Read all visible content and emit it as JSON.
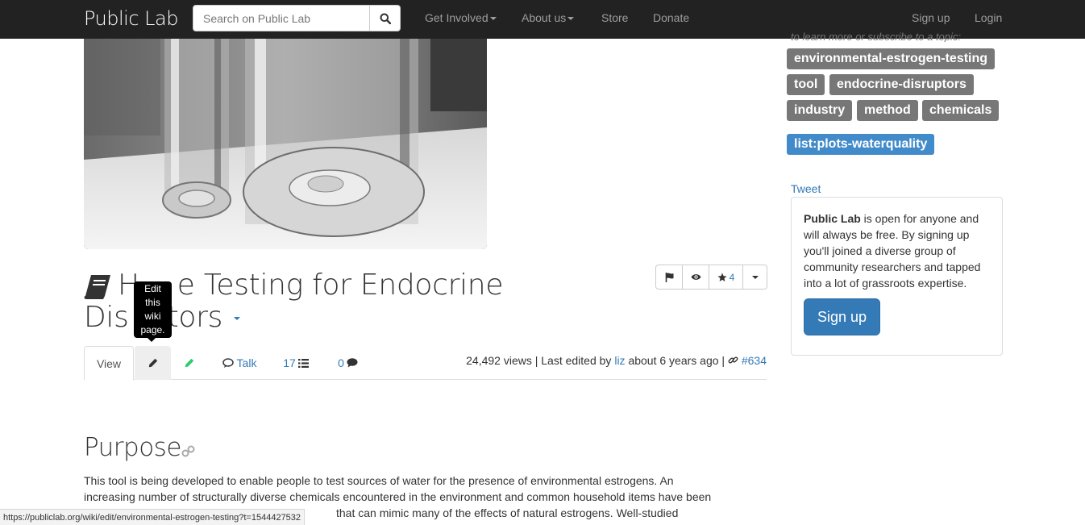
{
  "navbar": {
    "brand": "Public Lab",
    "search_placeholder": "Search on Public Lab",
    "items": [
      "Get Involved",
      "About us",
      "Store",
      "Donate"
    ],
    "signup": "Sign up",
    "login": "Login"
  },
  "page": {
    "title": "Home Testing for Endocrine Disruptors",
    "title_part1": "H",
    "title_part2": "e Testing for Endocrine",
    "title_part3": "Dis",
    "title_part4": "tors",
    "tooltip": "Edit this wiki page.",
    "tooltip_lines": [
      "Edit",
      "this",
      "wiki",
      "page."
    ],
    "like_count": "4",
    "tabs": {
      "view": "View",
      "talk": "Talk",
      "revisions": "17",
      "comments": "0"
    },
    "meta": {
      "views": "24,492 views | Last edited by",
      "author": "liz",
      "time": "about 6 years ago |",
      "node": "#634"
    }
  },
  "content": {
    "heading": "Purpose",
    "paragraph_line1": "This tool is being developed to enable people to test sources of water for the presence of environmental estrogens. An",
    "paragraph_line2": "increasing number of structurally diverse chemicals encountered in the environment and common household items have been",
    "paragraph_line3": "that can mimic many of the effects of natural estrogens. Well-studied"
  },
  "statusbar": {
    "url": "https://publiclab.org/wiki/edit/environmental-estrogen-testing?t=1544427532"
  },
  "sidebar": {
    "cut_text": "to learn more or subscribe to a topic:",
    "tags": [
      "environmental-estrogen-testing",
      "tool",
      "endocrine-disruptors",
      "industry",
      "method",
      "chemicals"
    ],
    "list_tag": "list:plots-waterquality",
    "tweet": "Tweet",
    "signup_bold": "Public Lab",
    "signup_text": " is open for anyone and will always be free. By signing up you'll joined a diverse group of community researchers and tapped into a lot of grassroots expertise.",
    "signup_button": "Sign up"
  },
  "colors": {
    "navbar_bg": "#222222",
    "link": "#337ab7",
    "tag_gray": "#777777",
    "tag_blue": "#428bca",
    "edit_green": "#2ecc71"
  },
  "icons": [
    "search-icon",
    "book-icon",
    "flag-icon",
    "eye-icon",
    "star-icon",
    "pencil-icon",
    "comments-icon",
    "list-icon",
    "comment-icon",
    "link-icon"
  ]
}
